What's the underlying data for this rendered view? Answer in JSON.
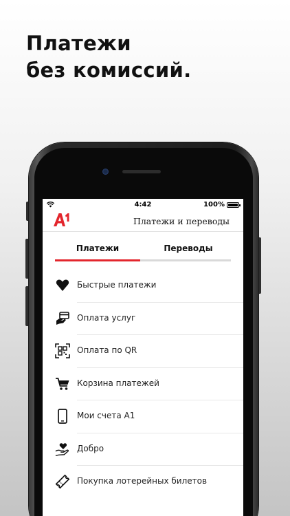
{
  "promo": {
    "line1": "Платежи",
    "line2": "без комиссий."
  },
  "status_bar": {
    "time": "4:42",
    "battery": "100%",
    "wifi_icon": "wifi-icon",
    "battery_icon": "battery-icon"
  },
  "header": {
    "logo": "A1",
    "title": "Платежи и переводы"
  },
  "tabs": [
    {
      "label": "Платежи",
      "active": true
    },
    {
      "label": "Переводы",
      "active": false
    }
  ],
  "menu": [
    {
      "label": "Быстрые платежи",
      "icon": "heart-icon"
    },
    {
      "label": "Оплата услуг",
      "icon": "card-payment-icon"
    },
    {
      "label": "Оплата по  QR",
      "icon": "qr-code-icon"
    },
    {
      "label": "Корзина платежей",
      "icon": "cart-icon"
    },
    {
      "label": "Мои счета А1",
      "icon": "phone-icon"
    },
    {
      "label": "Добро",
      "icon": "heart-hand-icon"
    },
    {
      "label": "Покупка лотерейных билетов",
      "icon": "ticket-icon"
    }
  ],
  "colors": {
    "accent": "#e3262d",
    "text": "#111111"
  }
}
